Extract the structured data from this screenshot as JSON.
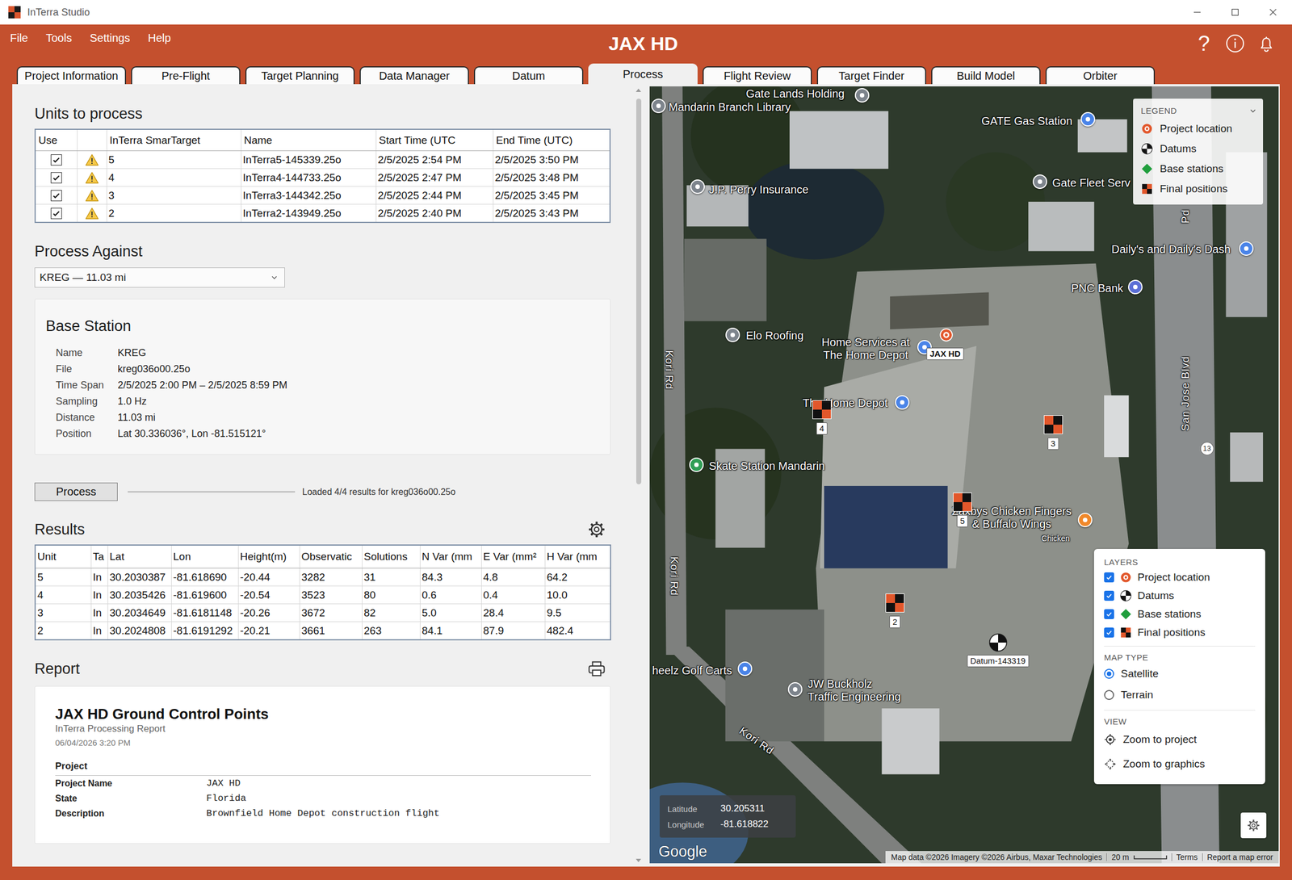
{
  "window": {
    "title": "InTerra Studio"
  },
  "menu": [
    "File",
    "Tools",
    "Settings",
    "Help"
  ],
  "project_title": "JAX HD",
  "header_help": "?",
  "tabs": [
    {
      "label": "Project Information",
      "selected": false
    },
    {
      "label": "Pre-Flight",
      "selected": false
    },
    {
      "label": "Target Planning",
      "selected": false
    },
    {
      "label": "Data Manager",
      "selected": false
    },
    {
      "label": "Datum",
      "selected": false
    },
    {
      "label": "Process",
      "selected": true
    },
    {
      "label": "Flight Review",
      "selected": false
    },
    {
      "label": "Target Finder",
      "selected": false
    },
    {
      "label": "Build Model",
      "selected": false
    },
    {
      "label": "Orbiter",
      "selected": false
    }
  ],
  "units": {
    "title": "Units to process",
    "columns": [
      "Use",
      "",
      "InTerra SmarTarget",
      "Name",
      "Start Time (UTC",
      "End Time (UTC)"
    ],
    "rows": [
      {
        "use": true,
        "warning": true,
        "unit": "5",
        "name": "InTerra5-145339.25o",
        "start": "2/5/2025 2:54 PM",
        "end": "2/5/2025 3:50 PM"
      },
      {
        "use": true,
        "warning": true,
        "unit": "4",
        "name": "InTerra4-144733.25o",
        "start": "2/5/2025 2:47 PM",
        "end": "2/5/2025 3:48 PM"
      },
      {
        "use": true,
        "warning": true,
        "unit": "3",
        "name": "InTerra3-144342.25o",
        "start": "2/5/2025 2:44 PM",
        "end": "2/5/2025 3:45 PM"
      },
      {
        "use": true,
        "warning": true,
        "unit": "2",
        "name": "InTerra2-143949.25o",
        "start": "2/5/2025 2:40 PM",
        "end": "2/5/2025 3:43 PM"
      }
    ]
  },
  "process_against": {
    "title": "Process Against",
    "value": "KREG — 11.03 mi"
  },
  "base_station": {
    "title": "Base Station",
    "fields": [
      {
        "label": "Name",
        "value": "KREG"
      },
      {
        "label": "File",
        "value": "kreg036o00.25o"
      },
      {
        "label": "Time Span",
        "value": "2/5/2025 2:00 PM – 2/5/2025 8:59 PM"
      },
      {
        "label": "Sampling",
        "value": "1.0 Hz"
      },
      {
        "label": "Distance",
        "value": "11.03 mi"
      },
      {
        "label": "Position",
        "value": "Lat 30.336036°, Lon -81.515121°"
      }
    ]
  },
  "process": {
    "button": "Process",
    "level": 1,
    "status": "Loaded 4/4 results for kreg036o00.25o"
  },
  "results": {
    "title": "Results",
    "columns": [
      "Unit",
      "Ta",
      "Lat",
      "Lon",
      "Height(m)",
      "Observatic",
      "Solutions",
      "N Var (mm",
      "E Var (mm²",
      "H Var (mm"
    ],
    "rows": [
      [
        "5",
        "In",
        "30.2030387",
        "-81.618690",
        "-20.44",
        "3282",
        "31",
        "84.3",
        "4.8",
        "64.2"
      ],
      [
        "4",
        "In",
        "30.2035426",
        "-81.619600",
        "-20.54",
        "3523",
        "80",
        "0.6",
        "0.4",
        "10.0"
      ],
      [
        "3",
        "In",
        "30.2034649",
        "-81.6181148",
        "-20.26",
        "3672",
        "82",
        "5.0",
        "28.4",
        "9.5"
      ],
      [
        "2",
        "In",
        "30.2024808",
        "-81.6191292",
        "-20.21",
        "3661",
        "263",
        "84.1",
        "87.9",
        "482.4"
      ]
    ]
  },
  "report": {
    "title": "Report",
    "heading": "JAX HD Ground Control Points",
    "subtitle": "InTerra Processing Report",
    "date": "06/04/2026 3:20 PM",
    "section": "Project",
    "fields": [
      {
        "label": "Project Name",
        "value": "JAX HD"
      },
      {
        "label": "State",
        "value": "Florida"
      },
      {
        "label": "Description",
        "value": "Brownfield Home Depot construction flight"
      }
    ]
  },
  "scrollbar": {
    "level": 0.51
  },
  "map": {
    "places": [
      {
        "kind": "place",
        "lines": [
          "Gate Lands Holding"
        ],
        "color": "#7d848c"
      },
      {
        "kind": "place",
        "lines": [
          "Mandarin Branch Library"
        ],
        "color": "#7d848c"
      },
      {
        "kind": "place",
        "lines": [
          "GATE Gas Station"
        ],
        "color": "#4a84e8"
      },
      {
        "kind": "place",
        "lines": [
          "J.P. Perry Insurance"
        ],
        "color": "#7d848c"
      },
      {
        "kind": "place",
        "lines": [
          "Gate Fleet Serv"
        ],
        "color": "#7d848c"
      },
      {
        "kind": "place",
        "lines": [
          "Daily's and Daily's Dash"
        ],
        "color": "#4a84e8"
      },
      {
        "kind": "place",
        "lines": [
          "PNC Bank"
        ],
        "color": "#5b6fd6"
      },
      {
        "kind": "place",
        "lines": [
          "Elo Roofing"
        ],
        "color": "#7d848c"
      },
      {
        "kind": "place",
        "lines": [
          "Home Services at",
          "The Home Depot"
        ],
        "color": "#4a84e8"
      },
      {
        "kind": "place",
        "lines": [
          "The Home Depot"
        ],
        "color": "#4a84e8"
      },
      {
        "kind": "place",
        "lines": [
          "Skate Station Mandarin"
        ],
        "color": "#2f9e55"
      },
      {
        "kind": "place",
        "lines": [
          "Zaxbys Chicken Fingers",
          "& Buffalo Wings"
        ],
        "color": "#f0882a"
      },
      {
        "kind": "caption",
        "lines": [
          "Chicken"
        ]
      },
      {
        "kind": "place",
        "lines": [
          "heelz Golf Carts"
        ],
        "color": "#4a84e8"
      },
      {
        "kind": "place",
        "lines": [
          "JW Buckholz",
          "Traffic Engineering"
        ],
        "color": "#7d848c"
      },
      {
        "kind": "road",
        "lines": [
          "Kori Rd"
        ]
      },
      {
        "kind": "road",
        "lines": [
          "Kori Rd"
        ]
      },
      {
        "kind": "road",
        "lines": [
          "Kori Rd"
        ]
      },
      {
        "kind": "road",
        "lines": [
          "San Jose Blvd"
        ]
      },
      {
        "kind": "road",
        "lines": [
          "Pd"
        ]
      },
      {
        "kind": "shield",
        "lines": [
          "13"
        ]
      }
    ],
    "project": {
      "label": "JAX HD"
    },
    "final_positions": [
      {
        "label": "4"
      },
      {
        "label": "3"
      },
      {
        "label": "5"
      },
      {
        "label": "2"
      }
    ],
    "datums": [
      {
        "label": "Datum-143319"
      }
    ],
    "legend": {
      "title": "LEGEND",
      "items": [
        {
          "kind": "project",
          "label": "Project location"
        },
        {
          "kind": "datum",
          "label": "Datums"
        },
        {
          "kind": "base",
          "label": "Base stations"
        },
        {
          "kind": "final",
          "label": "Final positions"
        }
      ]
    },
    "layers": {
      "title": "LAYERS",
      "items": [
        {
          "kind": "project",
          "label": "Project location",
          "checked": true
        },
        {
          "kind": "datum",
          "label": "Datums",
          "checked": true
        },
        {
          "kind": "base",
          "label": "Base stations",
          "checked": true
        },
        {
          "kind": "final",
          "label": "Final positions",
          "checked": true
        }
      ]
    },
    "map_type": {
      "title": "MAP TYPE",
      "options": [
        {
          "label": "Satellite",
          "selected": true
        },
        {
          "label": "Terrain",
          "selected": false
        }
      ]
    },
    "view": {
      "title": "VIEW",
      "items": [
        {
          "kind": "project",
          "label": "Zoom to project"
        },
        {
          "kind": "graphics",
          "label": "Zoom to graphics"
        }
      ]
    },
    "cursor": [
      {
        "label": "Latitude",
        "value": "30.205311"
      },
      {
        "label": "Longitude",
        "value": "-81.618822"
      }
    ],
    "logo": "Google",
    "attribution": {
      "data": "Map data ©2026 Imagery ©2026 Airbus, Maxar Technologies",
      "scale": "20 m",
      "terms": "Terms",
      "report": "Report a map error"
    }
  }
}
